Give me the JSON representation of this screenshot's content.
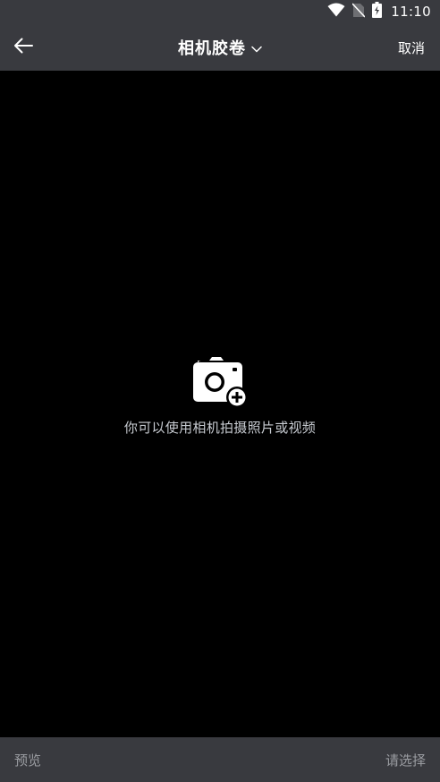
{
  "status_bar": {
    "time": "11:10",
    "icons": [
      "wifi-icon",
      "no-sim-icon",
      "battery-charging-icon"
    ]
  },
  "header": {
    "back_icon": "arrow-left-icon",
    "title": "相机胶卷",
    "dropdown_icon": "chevron-down-icon",
    "cancel_label": "取消"
  },
  "main": {
    "empty_icon": "camera-add-icon",
    "empty_text": "你可以使用相机拍摄照片或视频"
  },
  "footer": {
    "preview_label": "预览",
    "select_label": "请选择"
  },
  "colors": {
    "bar_background": "#393A3F",
    "content_background": "#000000",
    "primary_text": "#FFFFFF",
    "secondary_text": "#C7CBD1",
    "disabled_text": "#9A9CA1"
  }
}
